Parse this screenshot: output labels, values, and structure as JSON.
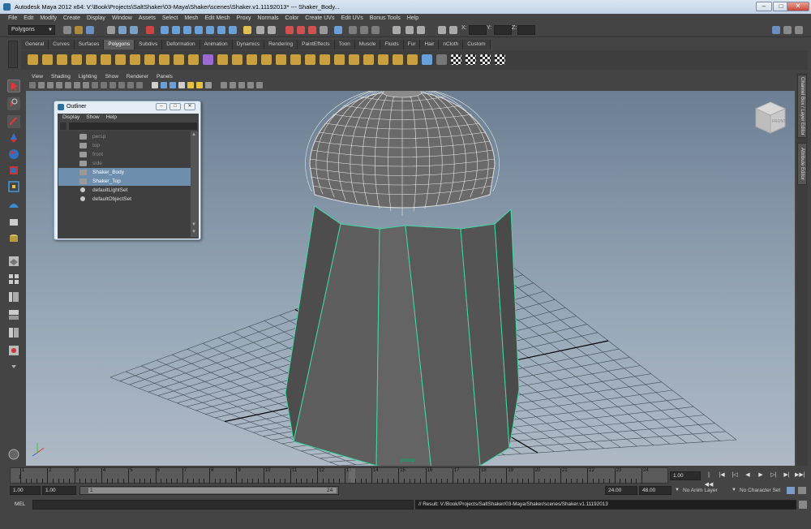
{
  "window": {
    "title": "Autodesk Maya 2012 x64: V:\\Book\\Projects\\SaltShaker\\03-Maya\\Shaker\\scenes\\Shaker.v1.11192013*   ---   Shaker_Body..."
  },
  "menubar": [
    "File",
    "Edit",
    "Modify",
    "Create",
    "Display",
    "Window",
    "Assets",
    "Select",
    "Mesh",
    "Edit Mesh",
    "Proxy",
    "Normals",
    "Color",
    "Create UVs",
    "Edit UVs",
    "Bonus Tools",
    "Help"
  ],
  "status_line": {
    "mode": "Polygons",
    "x_label": "X:",
    "y_label": "Y:",
    "z_label": "Z:"
  },
  "shelf": {
    "tabs": [
      "General",
      "Curves",
      "Surfaces",
      "Polygons",
      "Subdivs",
      "Deformation",
      "Animation",
      "Dynamics",
      "Rendering",
      "PaintEffects",
      "Toon",
      "Muscle",
      "Fluids",
      "Fur",
      "Hair",
      "nCloth",
      "Custom"
    ],
    "active_tab": "Polygons"
  },
  "panel": {
    "menus": [
      "View",
      "Shading",
      "Lighting",
      "Show",
      "Renderer",
      "Panels"
    ],
    "camera": "persp",
    "viewcube_label": "FRONT"
  },
  "right_dock": {
    "tabs": [
      "Channel Box / Layer Editor",
      "Attribute Editor"
    ]
  },
  "outliner": {
    "title": "Outliner",
    "menus": [
      "Display",
      "Show",
      "Help"
    ],
    "items": [
      {
        "label": "persp",
        "state": "dim",
        "icon": "camera-icon"
      },
      {
        "label": "top",
        "state": "dim",
        "icon": "camera-icon"
      },
      {
        "label": "front",
        "state": "dim",
        "icon": "camera-icon"
      },
      {
        "label": "side",
        "state": "dim",
        "icon": "camera-icon"
      },
      {
        "label": "Shaker_Body",
        "state": "selected",
        "icon": "mesh-icon"
      },
      {
        "label": "Shaker_Top",
        "state": "selected",
        "icon": "mesh-icon"
      },
      {
        "label": "defaultLightSet",
        "state": "normal",
        "icon": "set-icon"
      },
      {
        "label": "defaultObjectSet",
        "state": "normal",
        "icon": "set-icon"
      }
    ]
  },
  "timeline": {
    "ticks": [
      "1",
      "2",
      "3",
      "4",
      "5",
      "6",
      "7",
      "8",
      "9",
      "10",
      "11",
      "12",
      "13",
      "14",
      "15",
      "16",
      "17",
      "18",
      "19",
      "20",
      "21",
      "22",
      "23",
      "24"
    ],
    "start_marker": "1",
    "current_frame": "1.00"
  },
  "range": {
    "start": "1.00",
    "playback_start": "1.00",
    "bar_start": "1",
    "bar_end": "24",
    "playback_end": "24.00",
    "end": "48.00",
    "anim_layer": "No Anim Layer",
    "character_set": "No Character Set"
  },
  "command_line": {
    "label": "MEL",
    "result": "// Result: V:/Book/Projects/SaltShaker/03-Maya/Shaker/scenes/Shaker.v1.11192013"
  },
  "colors": {
    "selection": "#6e8eae",
    "wireframe_highlight": "#3fd9a0",
    "viewport_top": "#6c7f93",
    "viewport_bottom": "#aeb9c5"
  }
}
